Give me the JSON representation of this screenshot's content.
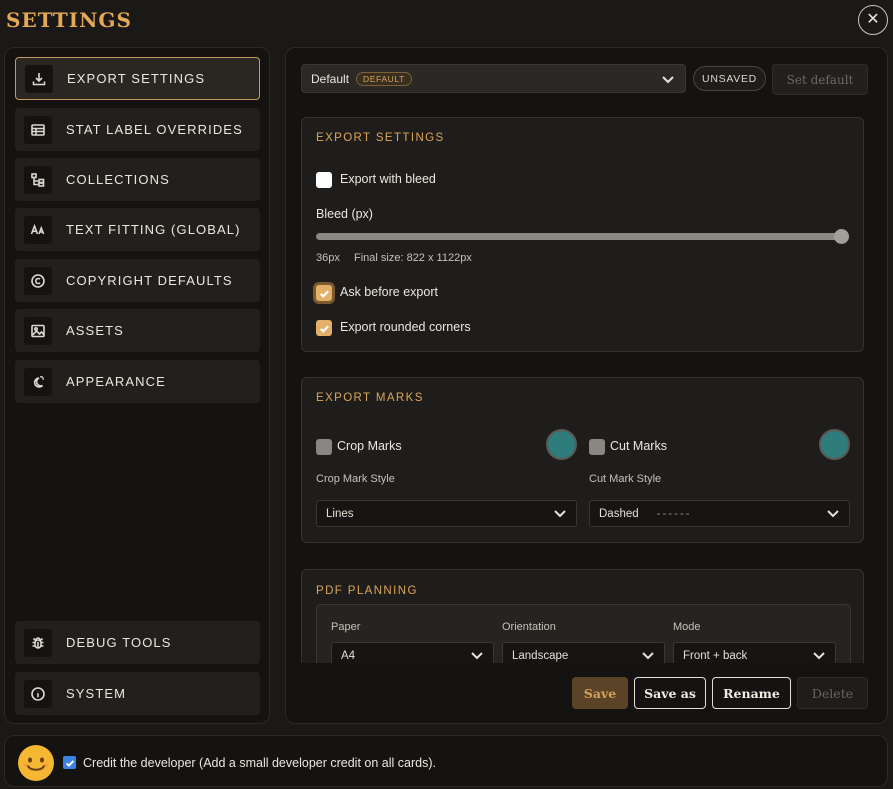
{
  "header": {
    "title": "SETTINGS",
    "close_icon": "close-icon"
  },
  "sidebar": {
    "items": [
      {
        "label": "EXPORT SETTINGS",
        "icon": "download-icon",
        "active": true
      },
      {
        "label": "STAT LABEL OVERRIDES",
        "icon": "table-icon"
      },
      {
        "label": "COLLECTIONS",
        "icon": "tree-icon"
      },
      {
        "label": "TEXT FITTING (GLOBAL)",
        "icon": "text-size-icon"
      },
      {
        "label": "COPYRIGHT DEFAULTS",
        "icon": "copyright-icon"
      },
      {
        "label": "ASSETS",
        "icon": "image-icon"
      },
      {
        "label": "APPEARANCE",
        "icon": "sun-moon-icon"
      }
    ],
    "bottom_items": [
      {
        "label": "DEBUG TOOLS",
        "icon": "bug-icon"
      },
      {
        "label": "SYSTEM",
        "icon": "info-icon"
      }
    ]
  },
  "preset": {
    "selected": "Default",
    "badge": "DEFAULT",
    "unsaved_label": "UNSAVED",
    "set_default_label": "Set default"
  },
  "export_settings": {
    "title": "EXPORT SETTINGS",
    "bleed_checkbox_label": "Export with bleed",
    "bleed_checked": false,
    "bleed_label": "Bleed (px)",
    "bleed_value_text": "36px",
    "bleed_fraction": 1.0,
    "final_size_text": "Final size: 822 x 1122px",
    "ask_label": "Ask before export",
    "ask_checked": true,
    "rounded_label": "Export rounded corners",
    "rounded_checked": true
  },
  "export_marks": {
    "title": "EXPORT MARKS",
    "crop_label": "Crop Marks",
    "crop_checked": false,
    "crop_color": "#2e7c7c",
    "cut_label": "Cut Marks",
    "cut_checked": false,
    "cut_color": "#2e7c7c",
    "crop_style_label": "Crop Mark Style",
    "crop_style_value": "Lines",
    "cut_style_label": "Cut Mark Style",
    "cut_style_value": "Dashed",
    "cut_style_preview": "------"
  },
  "pdf_planning": {
    "title": "PDF PLANNING",
    "paper_label": "Paper",
    "paper_value": "A4",
    "orientation_label": "Orientation",
    "orientation_value": "Landscape",
    "mode_label": "Mode",
    "mode_value": "Front + back"
  },
  "actions": {
    "save_label": "Save",
    "save_as_label": "Save as",
    "rename_label": "Rename",
    "delete_label": "Delete"
  },
  "credit": {
    "checked": true,
    "label": "Credit the developer (Add a small developer credit on all cards)."
  },
  "colors": {
    "accent": "#dba55a",
    "background": "#1b1917",
    "panel": "#151312",
    "checkbox_blue": "#3b82e6"
  }
}
